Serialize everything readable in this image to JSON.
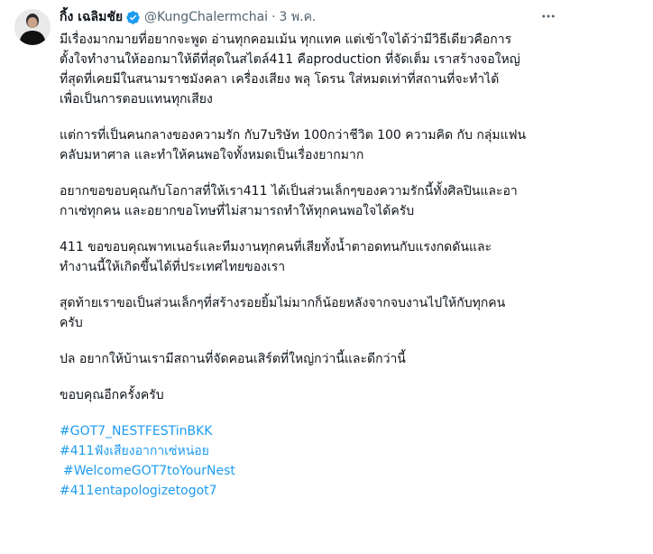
{
  "author": {
    "display_name": "กิ้ง เฉลิมชัย",
    "handle": "@KungChalermchai",
    "separator": "·",
    "date": "3 พ.ค."
  },
  "icons": {
    "verified": "verified-badge-icon",
    "more": "more-options-icon"
  },
  "colors": {
    "link": "#1d9bf0",
    "text": "#0f1419",
    "secondary": "#536471",
    "verified": "#1d9bf0"
  },
  "paragraphs": [
    [
      "มีเรื่องมากมายที่อยากจะพูด อ่านทุกคอมเม้น ทุกแทค แต่เข้าใจได้ว่ามีวิธีเดียวคือการ",
      "ตั้งใจทำงานให้ออกมาให้ดีที่สุดในสไตล์411 คือproduction ที่จัดเต็ม เราสร้างจอใหญ่",
      "ที่สุดที่เคยมีในสนามราชมังคลา เครื่องเสียง พลุ โดรน ใส่หมดเท่าที่สถานที่จะทำได้",
      "เพื่อเป็นการตอบแทนทุกเสียง"
    ],
    [
      "แต่การที่เป็นคนกลางของความรัก กับ7บริษัท 100กว่าชีวิต 100 ความคิด กับ กลุ่มแฟน",
      "คลับมหาศาล และทำให้คนพอใจทั้งหมดเป็นเรื่องยากมาก"
    ],
    [
      "อยากขอขอบคุณกับโอกาสที่ให้เรา411 ได้เป็นส่วนเล็กๆของความรักนี้ทั้งศิลปินและอา",
      "กาเซ่ทุกคน และอยากขอโทษที่ไม่สามารถทำให้ทุกคนพอใจได้ครับ"
    ],
    [
      "411 ขอขอบคุณพาทเนอร์และทีมงานทุกคนที่เสียทั้งน้ำตาอดทนกับแรงกดดันและ",
      "ทำงานนี้ให้เกิดขึ้นได้ที่ประเทศไทยของเรา"
    ],
    [
      "สุดท้ายเราขอเป็นส่วนเล็กๆที่สร้างรอยยิ้มไม่มากก็น้อยหลังจากจบงานไปให้กับทุกคน",
      "ครับ"
    ],
    [
      "ปล อยากให้บ้านเรามีสถานที่จัดคอนเสิร์ตที่ใหญ่กว่านี้และดีกว่านี้"
    ],
    [
      "ขอบคุณอีกครั้งครับ"
    ]
  ],
  "hashtags": [
    "#GOT7_NESTFESTinBKK",
    "#411ฟังเสียงอากาเซ่หน่อย",
    "#WelcomeGOT7toYourNest",
    "#411entapologizetogot7"
  ]
}
